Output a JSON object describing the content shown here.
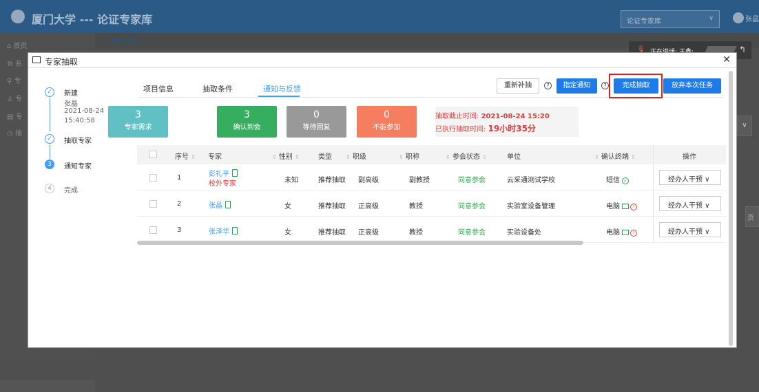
{
  "app": {
    "title": "厦门大学 --- 论证专家库",
    "select_value": "论证专家库",
    "user": "张晶"
  },
  "sidebar": {
    "items": [
      "首页",
      "系",
      "专",
      "专",
      "专",
      "抽"
    ]
  },
  "bg": {
    "tab": "专家抽取",
    "right_btn": "∨",
    "right_text": "页"
  },
  "talk": {
    "text": "正在讲话: 王鑫;"
  },
  "modal": {
    "title": "专家抽取"
  },
  "steps": [
    {
      "label": "新建",
      "sub1": "张晶",
      "sub2": "2021-08-24",
      "sub3": "15:40:58"
    },
    {
      "label": "抽取专家"
    },
    {
      "label": "通知专家",
      "num": "3"
    },
    {
      "label": "完成",
      "num": "4"
    }
  ],
  "tabs": [
    "项目信息",
    "抽取条件",
    "通知与反馈"
  ],
  "buttons": {
    "resupply": "重新补抽",
    "assign": "指定通知",
    "finish": "完成抽取",
    "abandon": "放弃本次任务"
  },
  "cards": [
    {
      "n": "3",
      "l": "专家需求",
      "color": "#61c0c4"
    },
    {
      "n": "3",
      "l": "确认到会",
      "color": "#36ad5f"
    },
    {
      "n": "0",
      "l": "等待回复",
      "color": "#999999"
    },
    {
      "n": "0",
      "l": "不能参加",
      "color": "#f47e5f"
    }
  ],
  "deadline": {
    "l1": "抽取截止时间: ",
    "v1": "2021-08-24 15:20",
    "l2": "已执行抽取时间: ",
    "v2": "19小时35分"
  },
  "table": {
    "headers": {
      "seq": "序号",
      "expert": "专家",
      "gender": "性别",
      "type": "类型",
      "level": "职级",
      "title": "职称",
      "status": "参会状态",
      "unit": "单位",
      "confirm": "确认终端",
      "op": "操作"
    },
    "rows": [
      {
        "seq": "1",
        "expert": "彭礼平",
        "note": "校外专家",
        "gender": "未知",
        "type": "推荐抽取",
        "level": "副高级",
        "title": "副教授",
        "status": "同意参会",
        "unit": "云采通测试学校",
        "confirm": "短信",
        "op": "经办人干预 ∨"
      },
      {
        "seq": "2",
        "expert": "张晶",
        "note": "",
        "gender": "女",
        "type": "推荐抽取",
        "level": "正高级",
        "title": "教授",
        "status": "同意参会",
        "unit": "实验室设备管理",
        "confirm": "电脑",
        "op": "经办人干预 ∨"
      },
      {
        "seq": "3",
        "expert": "张泽华",
        "note": "",
        "gender": "女",
        "type": "推荐抽取",
        "level": "正高级",
        "title": "教授",
        "status": "同意参会",
        "unit": "实验设备处",
        "confirm": "电脑",
        "op": "经办人干预 ∨"
      }
    ]
  }
}
